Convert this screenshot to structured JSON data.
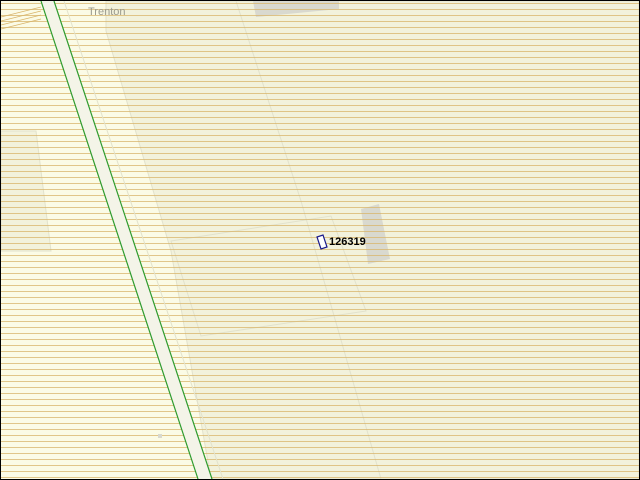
{
  "map": {
    "place_name": "Trenton",
    "building_id": "126319",
    "colors": {
      "background": "#fbfbe6",
      "hatch_line": "#d8b46a",
      "parcel": "#f2f2dc",
      "parcel_outline": "#e2e2cc",
      "grey_block": "#d9d9cf",
      "road_fill": "#f4f4e8",
      "road_edge": "#2e9b2e",
      "building_outline": "#1a1a8c",
      "building_fill": "#ffffff"
    }
  }
}
